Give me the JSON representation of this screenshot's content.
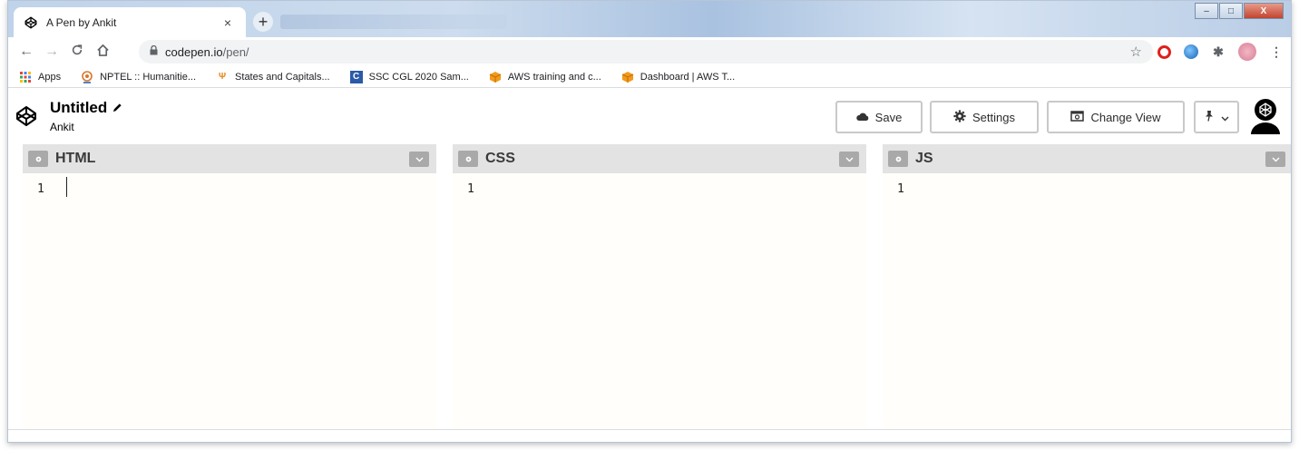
{
  "browser": {
    "tab_title": "A Pen by Ankit",
    "tab_close": "×",
    "new_tab": "+",
    "url_host": "codepen.io",
    "url_path": "/pen/",
    "window_controls": {
      "minimize": "–",
      "maximize": "□",
      "close": "X"
    }
  },
  "bookmarks": [
    {
      "label": "Apps",
      "icon": "apps-grid-icon"
    },
    {
      "label": "NPTEL :: Humanitie...",
      "icon": "nptel-icon"
    },
    {
      "label": "States and Capitals...",
      "icon": "states-icon"
    },
    {
      "label": "SSC CGL 2020 Sam...",
      "icon": "c-letter-icon"
    },
    {
      "label": "AWS training and c...",
      "icon": "aws-cube-icon"
    },
    {
      "label": "Dashboard | AWS T...",
      "icon": "aws-cube-icon"
    }
  ],
  "pen": {
    "title": "Untitled",
    "author": "Ankit"
  },
  "header_buttons": {
    "save": "Save",
    "settings": "Settings",
    "change_view": "Change View"
  },
  "editors": [
    {
      "title": "HTML",
      "line": "1"
    },
    {
      "title": "CSS",
      "line": "1"
    },
    {
      "title": "JS",
      "line": "1"
    }
  ],
  "colors": {
    "panel_header": "#e3e3e3",
    "editor_bg": "#fffefa",
    "opera_red": "#e0201b"
  }
}
